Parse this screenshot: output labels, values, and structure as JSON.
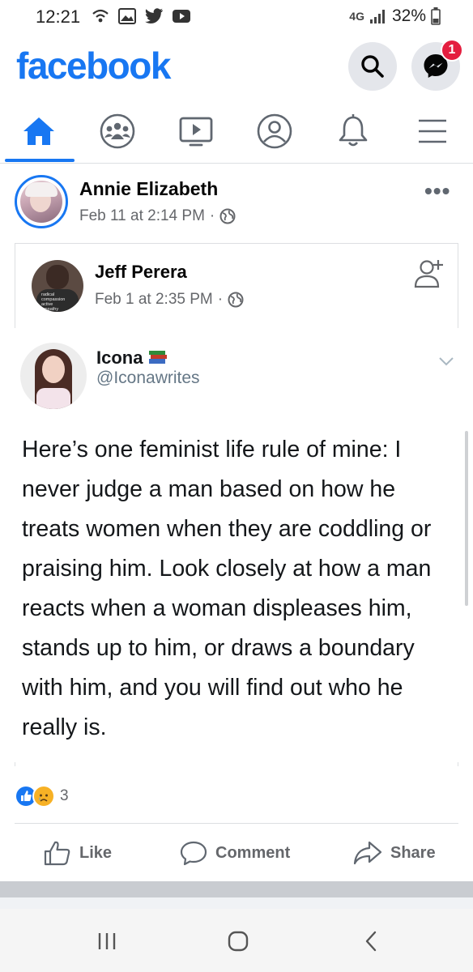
{
  "status_bar": {
    "time": "12:21",
    "network": "4G",
    "battery": "32%"
  },
  "header": {
    "logo": "facebook",
    "brand_color": "#1877f2",
    "search_icon": "search-icon",
    "messenger_icon": "messenger-icon",
    "messenger_badge": "1"
  },
  "nav_tabs": [
    {
      "name": "home",
      "icon": "home-icon",
      "active": true
    },
    {
      "name": "groups",
      "icon": "groups-icon",
      "active": false
    },
    {
      "name": "watch",
      "icon": "video-icon",
      "active": false
    },
    {
      "name": "profile",
      "icon": "profile-icon",
      "active": false
    },
    {
      "name": "notifications",
      "icon": "bell-icon",
      "active": false
    },
    {
      "name": "menu",
      "icon": "menu-icon",
      "active": false
    }
  ],
  "post": {
    "author": "Annie Elizabeth",
    "date": "Feb 11 at 2:14 PM",
    "separator": "·",
    "privacy_icon": "globe-icon",
    "more_label": "•••",
    "shared": {
      "author": "Jeff Perera",
      "date": "Feb 1 at 2:35 PM",
      "separator": "·",
      "privacy_icon": "globe-icon",
      "avatar_shirt_text": "radical compassion active empathy",
      "tweet": {
        "name": "Icona",
        "name_emoji": "books-emoji",
        "handle": "@Iconawrites",
        "text": "Here’s one feminist life rule of mine: I never judge a man based on how he treats women when they are coddling or praising him. Look closely at how a man reacts when a woman displeases him, stands up to him, or draws a boundary with him, and you will find out who he really is."
      }
    },
    "reactions": {
      "types": [
        "like",
        "sad"
      ],
      "count": "3"
    },
    "actions": {
      "like": "Like",
      "comment": "Comment",
      "share": "Share"
    }
  },
  "android_nav": {
    "recent": "recent-apps-icon",
    "home": "home-button-icon",
    "back": "back-icon"
  }
}
